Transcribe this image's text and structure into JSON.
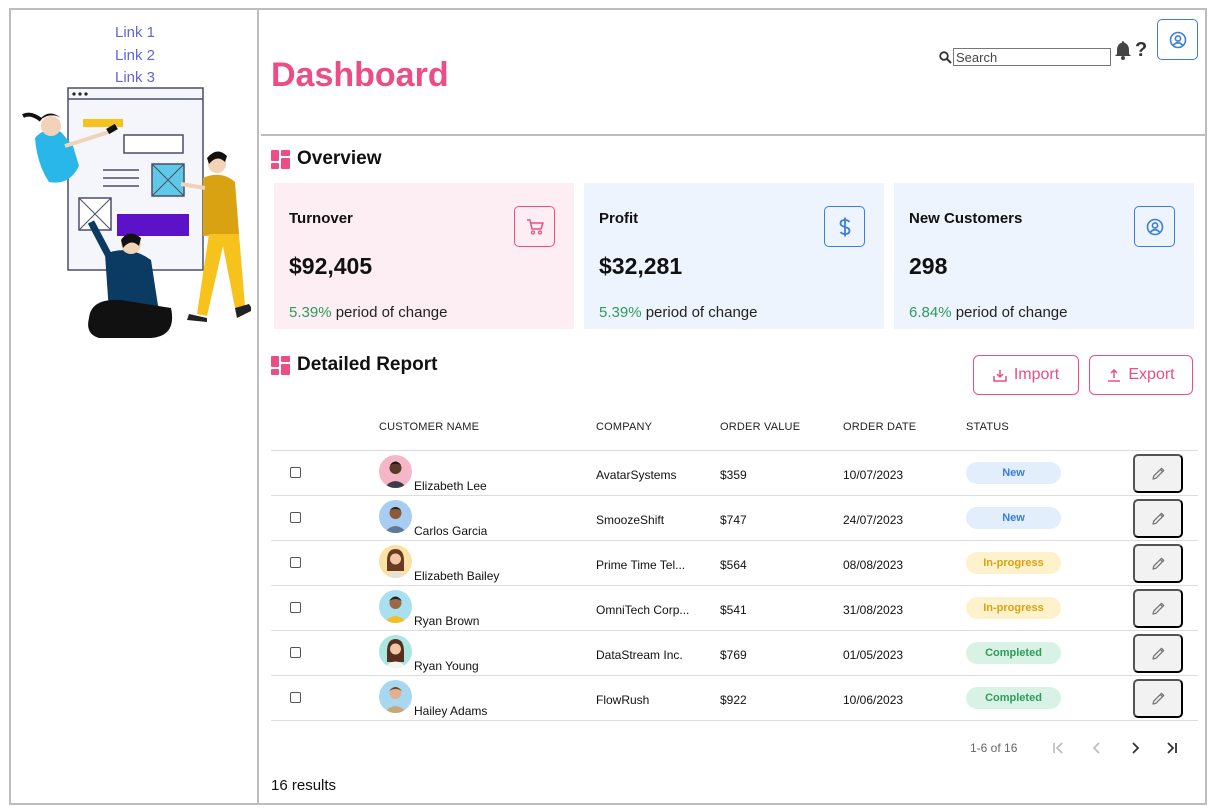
{
  "sidebar": {
    "links": [
      "Link 1",
      "Link 2",
      "Link 3"
    ]
  },
  "header": {
    "title": "Dashboard",
    "search_placeholder": "Search",
    "help_label": "?"
  },
  "overview": {
    "title": "Overview",
    "cards": [
      {
        "label": "Turnover",
        "value": "$92,405",
        "change": "5.39%",
        "change_text": " period of change",
        "icon": "cart-icon",
        "theme": "pink"
      },
      {
        "label": "Profit",
        "value": "$32,281",
        "change": "5.39%",
        "change_text": " period of change",
        "icon": "dollar-icon",
        "theme": "blue"
      },
      {
        "label": "New Customers",
        "value": "298",
        "change": "6.84%",
        "change_text": " period of change",
        "icon": "user-circle-icon",
        "theme": "blue"
      }
    ]
  },
  "report": {
    "title": "Detailed Report",
    "import_label": "Import",
    "export_label": "Export",
    "columns": [
      "CUSTOMER NAME",
      "COMPANY",
      "ORDER VALUE",
      "ORDER DATE",
      "STATUS"
    ],
    "rows": [
      {
        "name": "Elizabeth Lee",
        "company": "AvatarSystems",
        "value": "$359",
        "date": "10/07/2023",
        "status": "New"
      },
      {
        "name": "Carlos Garcia",
        "company": "SmoozeShift",
        "value": "$747",
        "date": "24/07/2023",
        "status": "New"
      },
      {
        "name": "Elizabeth Bailey",
        "company": "Prime Time Tel...",
        "value": "$564",
        "date": "08/08/2023",
        "status": "In-progress"
      },
      {
        "name": "Ryan Brown",
        "company": "OmniTech Corp...",
        "value": "$541",
        "date": "31/08/2023",
        "status": "In-progress"
      },
      {
        "name": "Ryan Young",
        "company": "DataStream Inc.",
        "value": "$769",
        "date": "01/05/2023",
        "status": "Completed"
      },
      {
        "name": "Hailey Adams",
        "company": "FlowRush",
        "value": "$922",
        "date": "10/06/2023",
        "status": "Completed"
      }
    ],
    "pagination": "1-6 of 16",
    "results": "16 results"
  },
  "colors": {
    "accent_pink": "#ec4d85",
    "accent_blue": "#3b7ddb",
    "link": "#6366d8",
    "positive": "#2e9c5b"
  }
}
